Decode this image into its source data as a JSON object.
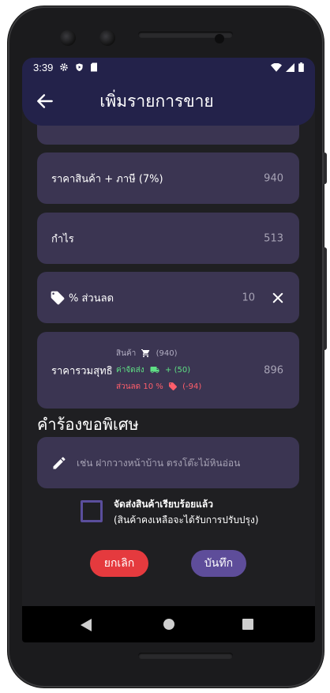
{
  "status_bar": {
    "time": "3:39"
  },
  "header": {
    "title": "เพิ่มรายการขาย"
  },
  "summary": {
    "price_with_tax_label": "ราคาสินค้า + ภาษี (7%)",
    "price_with_tax_value": "940",
    "profit_label": "กำไร",
    "profit_value": "513",
    "discount_label": "% ส่วนลด",
    "discount_value": "10",
    "net_label": "ราคารวมสุทธิ",
    "net_value": "896",
    "breakdown": {
      "product_label": "สินค้า",
      "product_value": "(940)",
      "shipping_label": "ค่าจัดส่ง",
      "shipping_value": "+ (50)",
      "discount_label": "ส่วนลด 10 %",
      "discount_value": "(-94)"
    }
  },
  "special_request": {
    "title": "คำร้องขอพิเศษ",
    "placeholder": "เช่น ฝากวางหน้าบ้าน ตรงโต๊ะไม้หินอ่อน",
    "value": ""
  },
  "delivered": {
    "label": "จัดส่งสินค้าเรียบร้อยแล้ว",
    "sublabel": "(สินค้าคงเหลือจะได้รับการปรับปรุง)",
    "checked": false
  },
  "actions": {
    "cancel": "ยกเลิก",
    "save": "บันทึก"
  },
  "colors": {
    "appbar": "#23224a",
    "card": "#3b3552",
    "cancel": "#e53a3e",
    "save": "#5e4d9a",
    "shipping_text": "#5fe085",
    "discount_text": "#ff5e6b"
  },
  "icons": [
    "back-arrow-icon",
    "tag-icon",
    "close-icon",
    "cart-icon",
    "truck-icon",
    "pencil-icon"
  ]
}
